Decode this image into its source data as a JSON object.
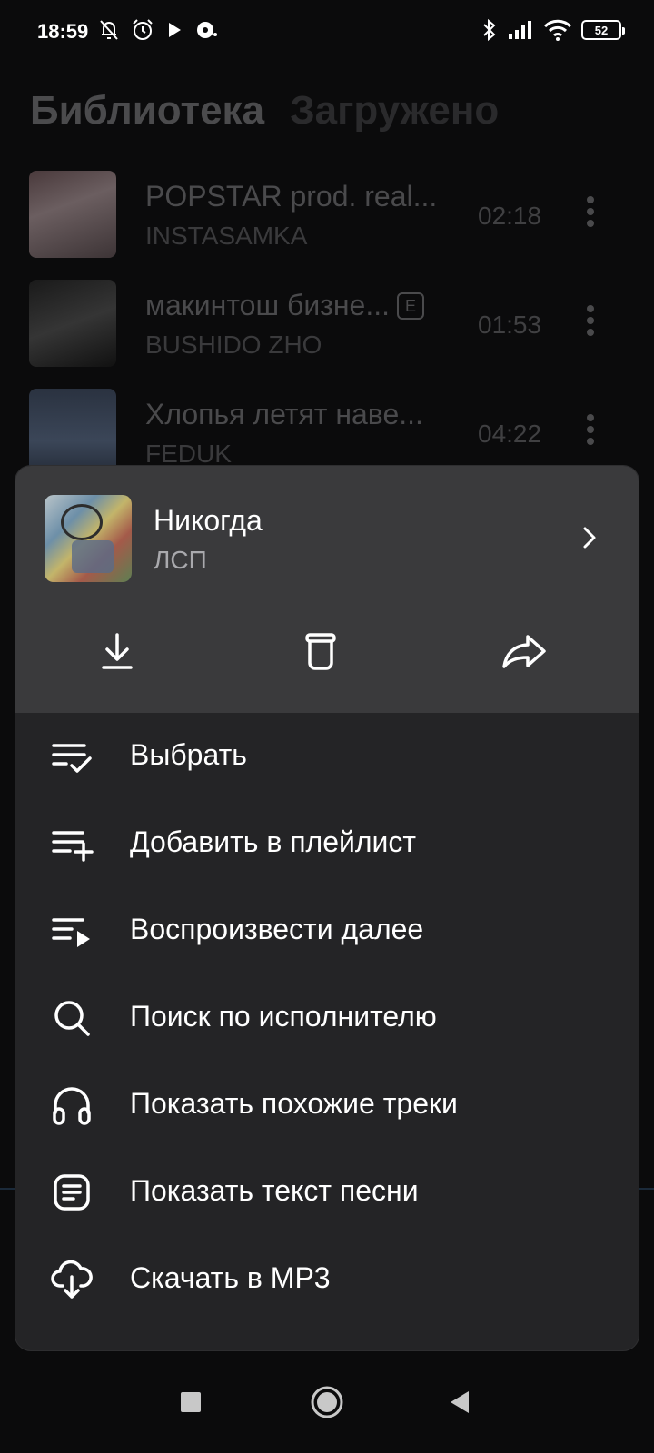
{
  "status_bar": {
    "time": "18:59",
    "battery": "52",
    "icons": [
      "bell-off-icon",
      "alarm-icon",
      "play-icon",
      "record-icon",
      "bluetooth-icon",
      "signal-icon",
      "wifi-icon",
      "battery-icon"
    ]
  },
  "tabs": [
    {
      "label": "Библиотека",
      "active": true
    },
    {
      "label": "Загружено",
      "active": false
    }
  ],
  "tracks": [
    {
      "title": "POPSTAR prod. real...",
      "artist": "INSTASAMKA",
      "duration": "02:18",
      "explicit": false
    },
    {
      "title": "макинтош бизне...",
      "artist": "BUSHIDO ZHO",
      "duration": "01:53",
      "explicit": true,
      "explicit_badge": "E"
    },
    {
      "title": "Хлопья летят наве...",
      "artist": "FEDUK",
      "duration": "04:22",
      "explicit": false
    }
  ],
  "sheet": {
    "title": "Никогда",
    "artist": "ЛСП",
    "actions": [
      "download-icon",
      "trash-icon",
      "share-icon"
    ],
    "menu": [
      {
        "label": "Выбрать",
        "icon": "select-list-icon"
      },
      {
        "label": "Добавить в плейлист",
        "icon": "playlist-add-icon"
      },
      {
        "label": "Воспроизвести далее",
        "icon": "play-next-icon"
      },
      {
        "label": "Поиск по исполнителю",
        "icon": "search-icon"
      },
      {
        "label": "Показать похожие треки",
        "icon": "headphones-icon"
      },
      {
        "label": "Показать текст песни",
        "icon": "lyrics-icon"
      },
      {
        "label": "Скачать в MP3",
        "icon": "cloud-download-icon"
      }
    ]
  },
  "colors": {
    "sheet_bg": "#242426",
    "sheet_header_bg": "#3a3a3c",
    "screen_bg": "#0b0b0c",
    "text_primary": "#ffffff",
    "text_secondary": "#a9a9ad"
  }
}
